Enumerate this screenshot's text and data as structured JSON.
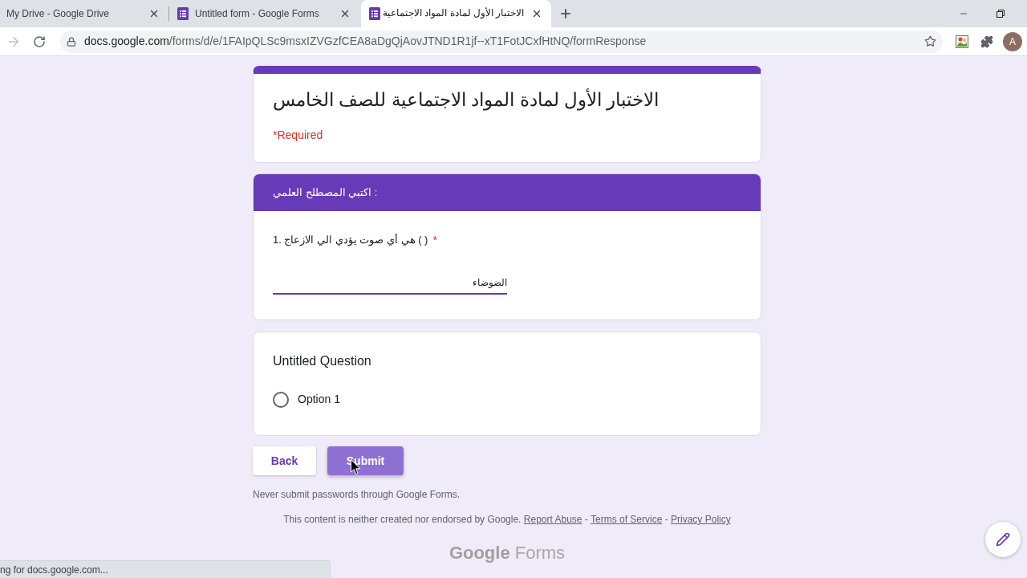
{
  "browser": {
    "tabs": [
      {
        "kind": "plain",
        "title": "My Drive - Google Drive",
        "selected": false
      },
      {
        "kind": "form",
        "title": "Untitled form - Google Forms",
        "selected": false
      },
      {
        "kind": "form",
        "title": "الاختبار الأول لمادة المواد الاجتماعية",
        "selected": true
      }
    ],
    "toolbar": {
      "forward_disabled": true,
      "address": {
        "host": "docs.google.com",
        "path": "/forms/d/e/1FAIpQLSc9msxIZVGzfCEA8aDgQjAovJTND1R1jf--xT1FotJCxfHtNQ/formResponse"
      },
      "profile_initial": "A"
    }
  },
  "form": {
    "title": "الاختبار الأول لمادة المواد الاجتماعية للصف الخامس",
    "required_note": "*Required",
    "section_title": "اكتبي المصطلح العلمي :",
    "questions": [
      {
        "kind": "short_answer",
        "title": "( ) هي أي صوت يؤدي الي الازعاج .1",
        "required_mark": "*",
        "value": "الضوضاء"
      },
      {
        "kind": "multiple_choice",
        "title": "Untitled Question",
        "options": [
          {
            "label": "Option 1",
            "selected": false
          }
        ]
      }
    ],
    "buttons": [
      {
        "label": "Back",
        "kind": "secondary"
      },
      {
        "label": "Submit",
        "kind": "primary"
      }
    ],
    "password_note": "Never submit passwords through Google Forms.",
    "footer": [
      {
        "kind": "text",
        "text": "This content is neither created nor endorsed by Google."
      },
      {
        "kind": "link",
        "text": "Report Abuse"
      },
      {
        "kind": "text",
        "text": "-"
      },
      {
        "kind": "link",
        "text": "Terms of Service"
      },
      {
        "kind": "text",
        "text": "-"
      },
      {
        "kind": "link",
        "text": "Privacy Policy"
      }
    ],
    "logo": {
      "brand": "Google",
      "product": "Forms"
    }
  },
  "status_bubble": "ng for docs.google.com..."
}
